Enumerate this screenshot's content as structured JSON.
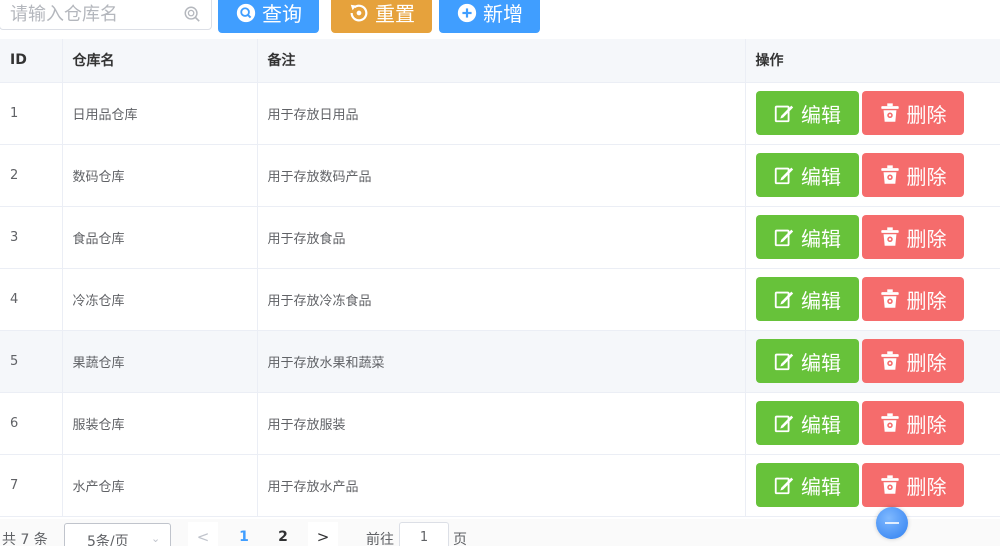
{
  "toolbar": {
    "search_placeholder": "请输入仓库名",
    "query_label": "查询",
    "reset_label": "重置",
    "add_label": "新增"
  },
  "table": {
    "headers": [
      "ID",
      "仓库名",
      "备注",
      "操作"
    ],
    "edit_label": "编辑",
    "delete_label": "删除",
    "rows": [
      {
        "id": "1",
        "name": "日用品仓库",
        "remark": "用于存放日用品"
      },
      {
        "id": "2",
        "name": "数码仓库",
        "remark": "用于存放数码产品"
      },
      {
        "id": "3",
        "name": "食品仓库",
        "remark": "用于存放食品"
      },
      {
        "id": "4",
        "name": "冷冻仓库",
        "remark": "用于存放冷冻食品"
      },
      {
        "id": "5",
        "name": "果蔬仓库",
        "remark": "用于存放水果和蔬菜"
      },
      {
        "id": "6",
        "name": "服装仓库",
        "remark": "用于存放服装"
      },
      {
        "id": "7",
        "name": "水产仓库",
        "remark": "用于存放水产品"
      }
    ]
  },
  "pagination": {
    "total_text": "共 7 条",
    "page_size": "5条/页",
    "prev": "<",
    "next": ">",
    "pages": [
      "1",
      "2"
    ],
    "current_page": "1",
    "goto_label": "前往",
    "goto_value": "1",
    "page_unit": "页"
  },
  "colors": {
    "primary": "#409eff",
    "warning": "#e6a23c",
    "success": "#67c23a",
    "danger": "#f56c6c"
  },
  "icons": {
    "search": "search-icon",
    "query": "search-circle-icon",
    "reset": "refresh-icon",
    "add": "plus-circle-icon",
    "edit": "edit-icon",
    "delete": "trash-icon"
  }
}
